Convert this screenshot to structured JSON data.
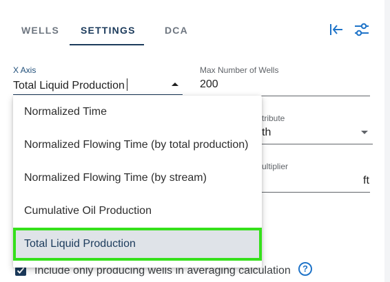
{
  "tabs": [
    {
      "label": "WELLS",
      "active": false
    },
    {
      "label": "SETTINGS",
      "active": true
    },
    {
      "label": "DCA",
      "active": false
    }
  ],
  "toolbar": {
    "collapse_icon": "collapse-left-icon",
    "filter_icon": "tune-sliders-icon"
  },
  "x_axis": {
    "label": "X Axis",
    "value": "Total Liquid Production"
  },
  "max_wells": {
    "label": "Max Number of Wells",
    "value": "200"
  },
  "partial_field_1": {
    "label_fragment": "tribute",
    "value_fragment": "th"
  },
  "partial_field_2": {
    "label_fragment": "ultiplier",
    "unit": "ft"
  },
  "dropdown": {
    "options": [
      "Normalized Time",
      "Normalized Flowing Time (by total production)",
      "Normalized Flowing Time (by stream)",
      "Cumulative Oil Production",
      "Total Liquid Production"
    ],
    "selected_index": 4
  },
  "producing_checkbox": {
    "label": "Include only producing wells in averaging calculation",
    "checked": true
  },
  "help_icon": "help-circle-icon",
  "colors": {
    "accent": "#1b3a5b",
    "icon_blue": "#1e73c8",
    "highlight": "#35e01b",
    "selected_bg": "#dfe3e8"
  }
}
